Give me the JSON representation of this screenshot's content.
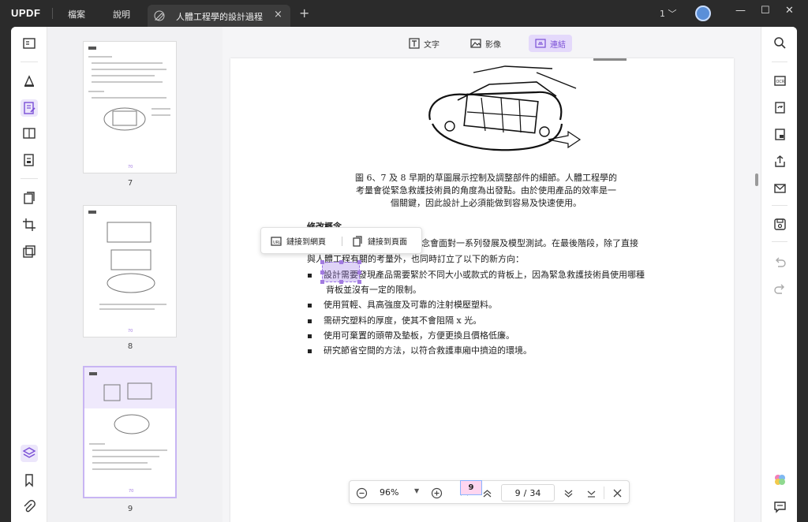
{
  "app": {
    "logo": "UPDF"
  },
  "menu": {
    "file": "檔案",
    "help": "說明"
  },
  "tab": {
    "title": "人體工程學的設計過程",
    "close": "×",
    "new_tab": "+"
  },
  "window": {
    "page_indicator": "1",
    "minimize": "—",
    "maximize": "☐",
    "close": "✕"
  },
  "edit_modes": [
    {
      "label": "文字"
    },
    {
      "label": "影像"
    },
    {
      "label": "連結"
    }
  ],
  "thumbnails": [
    {
      "page": "7",
      "footer": "70"
    },
    {
      "page": "8",
      "footer": "70"
    },
    {
      "page": "9",
      "footer": "70"
    }
  ],
  "document": {
    "caption": "圖 6、7 及 8 早期的草圖展示控制及調整部件的細節。人體工程學的考量會從緊急救護技術員的角度為出發點。由於使用產品的效率是一個關鍵，因此設計上必須能做到容易及快速使用。",
    "section_heading": "修改概念",
    "para_line1": "設計念會面對一系列發展及模型測試。在最後階段，除了直接",
    "para_line2": "與人體工程有關的考量外，也同時訂立了以下的新方向：",
    "bullets": [
      "設計需要發現產品需要緊於不同大小或款式的背板上，因為緊急救護技術員使用哪種",
      "使用質輕、具高強度及可靠的注射模壓塑料。",
      "需研究塑料的厚度，使其不會阻隔 x 光。",
      "使用可棄置的頭帶及墊板，方便更換且價格低廉。",
      "研究節省空間的方法，以符合救護車廂中擠迫的環境。"
    ],
    "bullet1_cont": "背板並沒有一定的限制。"
  },
  "link_popover": {
    "to_web": "鏈接到網頁",
    "to_page": "鏈接到頁面"
  },
  "zoom_bar": {
    "zoom": "96%",
    "current_page": "9",
    "separator": "/",
    "total_pages": "34"
  },
  "page_badge": "9",
  "colors": {
    "accent": "#7a4fd6",
    "titlebar": "#2b2b2b"
  }
}
